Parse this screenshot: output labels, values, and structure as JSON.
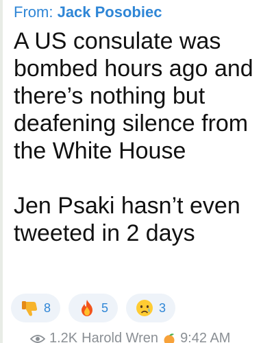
{
  "forward": {
    "prefix": "From:",
    "author": "Jack Posobiec"
  },
  "message": {
    "paragraph_1": "A US consulate was bombed hours ago and there’s nothing but deafening silence from the White House",
    "paragraph_2": "Jen Psaki hasn’t even tweeted in 2 days"
  },
  "reactions": [
    {
      "emoji": "thumbs-down",
      "count": "8"
    },
    {
      "emoji": "fire",
      "count": "5"
    },
    {
      "emoji": "crying-face",
      "count": "3"
    }
  ],
  "meta": {
    "views": "1.2K",
    "author_signature": "Harold Wren",
    "time": "9:42 AM"
  },
  "colors": {
    "accent": "#2f86d6",
    "reaction_bg": "#eef3f9",
    "meta_text": "#8a8f94"
  }
}
